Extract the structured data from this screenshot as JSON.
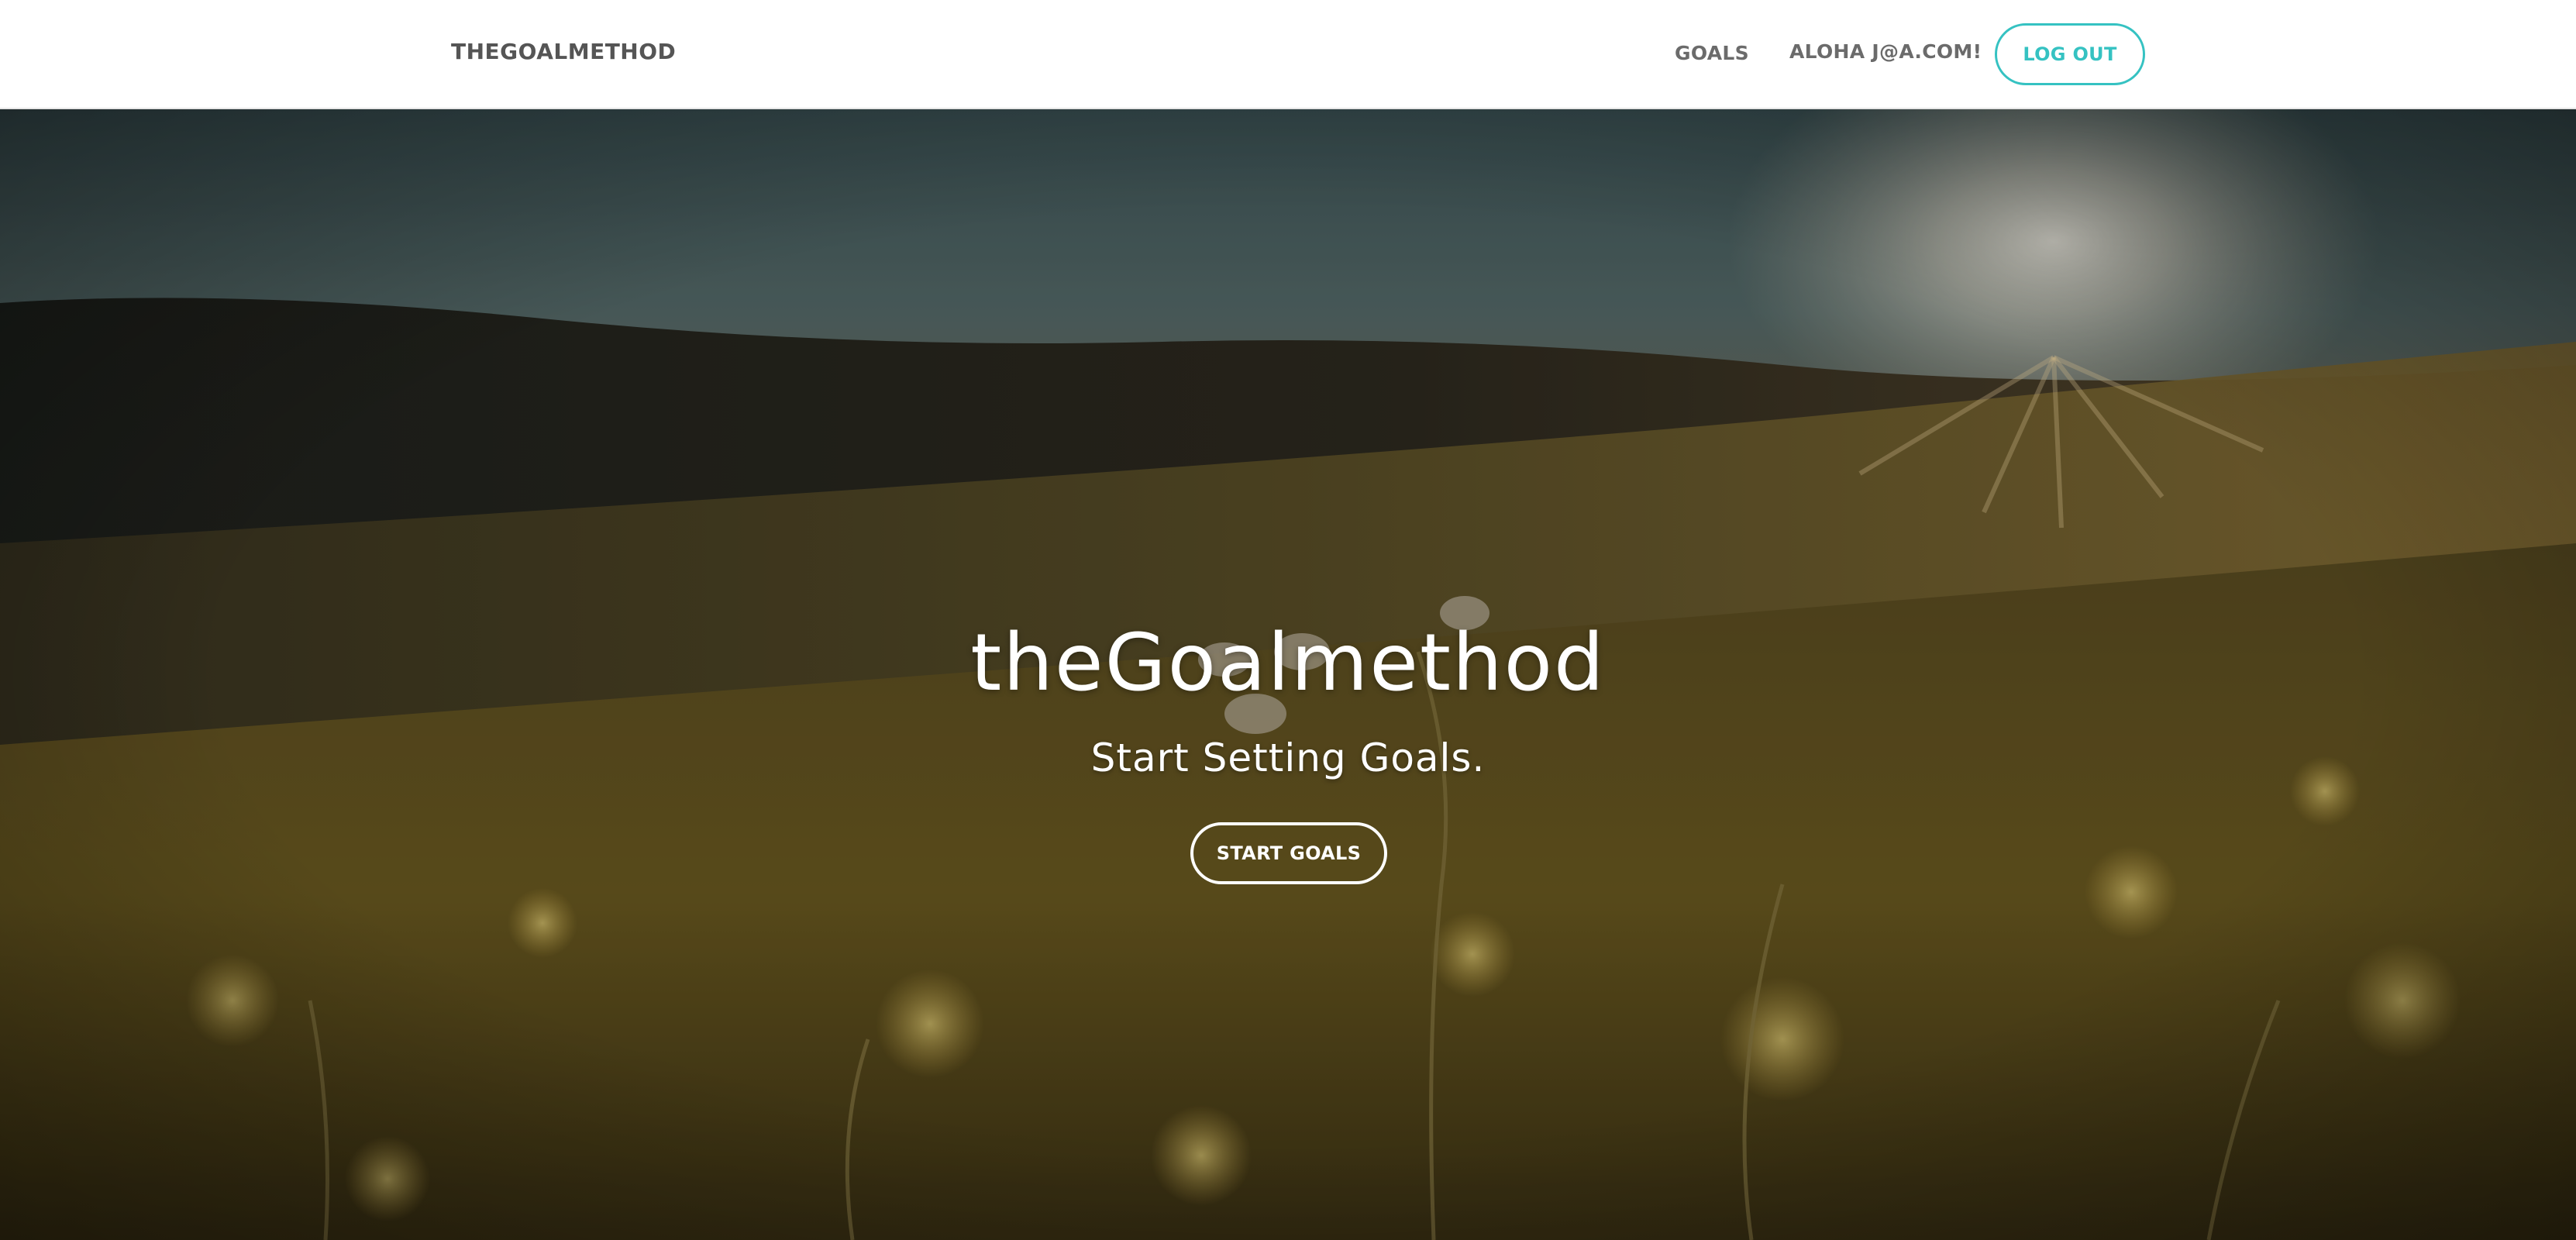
{
  "navbar": {
    "brand": "THEGOALMETHOD",
    "links": {
      "goals": "GOALS",
      "greeting": "ALOHA J@A.COM!"
    },
    "logout_label": "LOG OUT"
  },
  "hero": {
    "title": "theGoalmethod",
    "subtitle": "Start Setting Goals.",
    "cta_label": "START GOALS",
    "background": "blurred-meadow-sunset-photo"
  },
  "colors": {
    "accent": "#35c2c2",
    "nav_text": "#6b6b6b",
    "hero_text": "#ffffff"
  }
}
